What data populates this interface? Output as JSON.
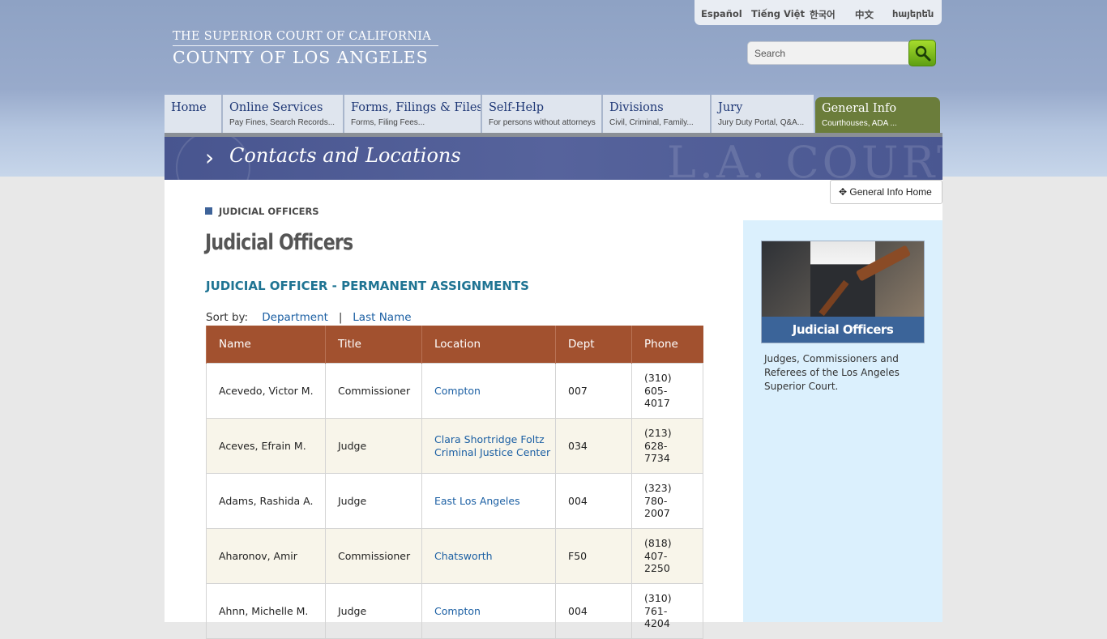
{
  "header": {
    "logo_line1": "THE SUPERIOR COURT OF CALIFORNIA",
    "logo_line2": "COUNTY OF LOS ANGELES",
    "languages": [
      "Español",
      "Tiếng Việt",
      "한국어",
      "中文",
      "հայերեն"
    ],
    "search_placeholder": "Search"
  },
  "nav": [
    {
      "title": "Home",
      "sub": ""
    },
    {
      "title": "Online Services",
      "sub": "Pay Fines, Search Records..."
    },
    {
      "title": "Forms, Filings & Files",
      "sub": "Forms, Filing Fees..."
    },
    {
      "title": "Self-Help",
      "sub": "For persons without attorneys"
    },
    {
      "title": "Divisions",
      "sub": "Civil, Criminal, Family..."
    },
    {
      "title": "Jury",
      "sub": "Jury Duty Portal, Q&A..."
    },
    {
      "title": "General Info",
      "sub": "Courthouses, ADA ..."
    }
  ],
  "banner": {
    "title": "Contacts and Locations",
    "watermark": "L.A. COURT"
  },
  "general_info_button": "General Info Home",
  "breadcrumb": "JUDICIAL OFFICERS",
  "page_title": "Judicial Officers",
  "section_title": "JUDICIAL OFFICER - PERMANENT ASSIGNMENTS",
  "sort": {
    "label": "Sort by:",
    "option1": "Department",
    "separator": "|",
    "option2": "Last Name"
  },
  "table": {
    "headers": [
      "Name",
      "Title",
      "Location",
      "Dept",
      "Phone"
    ],
    "rows": [
      {
        "name": "Acevedo, Victor M.",
        "title": "Commissioner",
        "location": "Compton",
        "dept": "007",
        "phone1": "(310)",
        "phone2": "605-",
        "phone3": "4017"
      },
      {
        "name": "Aceves, Efrain M.",
        "title": "Judge",
        "location": "Clara Shortridge Foltz Criminal Justice Center",
        "dept": "034",
        "phone1": "(213)",
        "phone2": "628-",
        "phone3": "7734"
      },
      {
        "name": "Adams, Rashida A.",
        "title": "Judge",
        "location": "East Los Angeles",
        "dept": "004",
        "phone1": "(323)",
        "phone2": "780-",
        "phone3": "2007"
      },
      {
        "name": "Aharonov, Amir",
        "title": "Commissioner",
        "location": "Chatsworth",
        "dept": "F50",
        "phone1": "(818)",
        "phone2": "407-",
        "phone3": "2250"
      },
      {
        "name": "Ahnn, Michelle M.",
        "title": "Judge",
        "location": "Compton",
        "dept": "004",
        "phone1": "(310)",
        "phone2": "761-",
        "phone3": "4204"
      }
    ]
  },
  "sidebar": {
    "card_caption": "Judicial Officers",
    "description": "Judges, Commissioners and Referees of the Los Angeles Superior Court."
  }
}
